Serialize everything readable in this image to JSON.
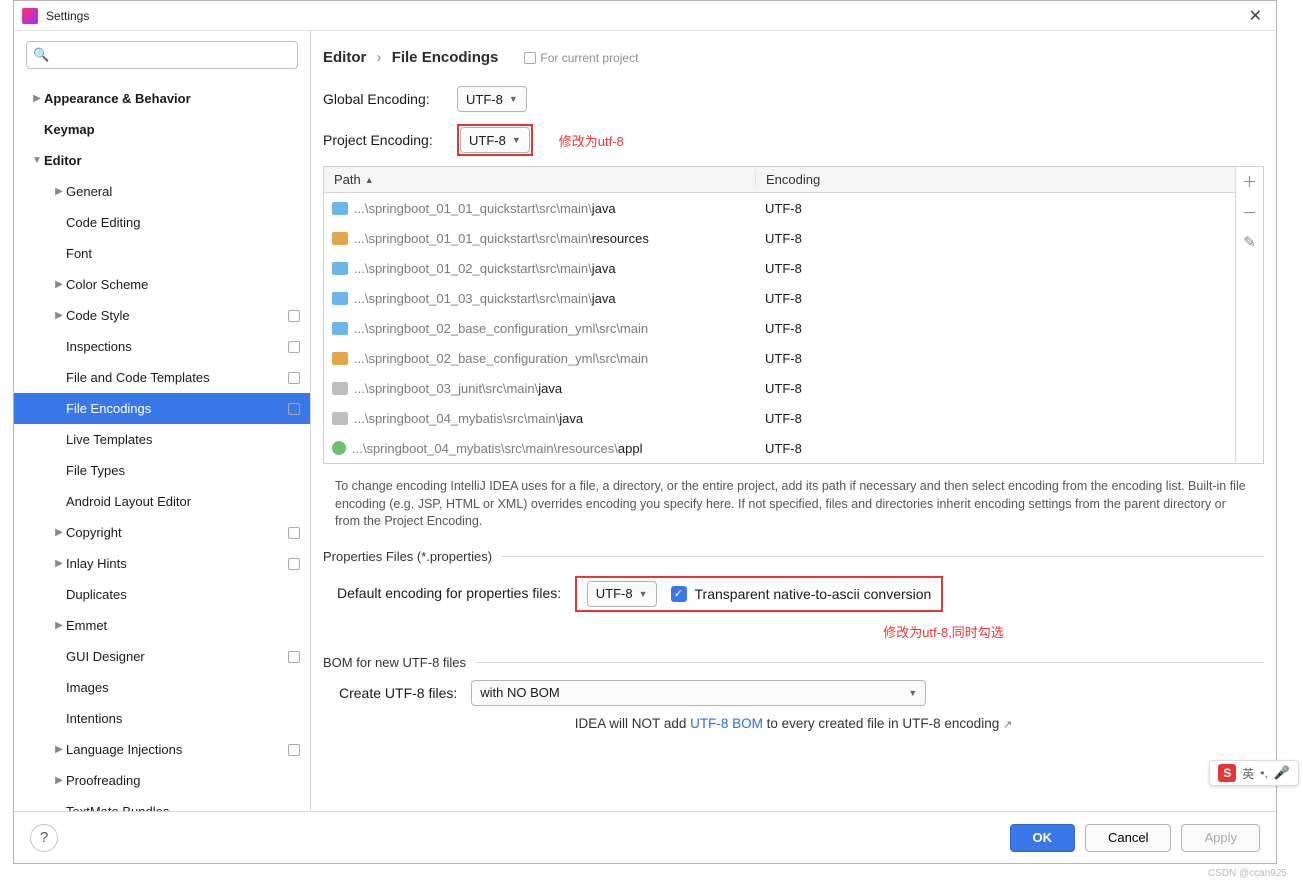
{
  "window": {
    "title": "Settings"
  },
  "sidebar": {
    "search_placeholder": "",
    "items": [
      {
        "label": "Appearance & Behavior",
        "level": 0,
        "arrow": "▶",
        "header": true
      },
      {
        "label": "Keymap",
        "level": 0,
        "arrow": "",
        "header": true
      },
      {
        "label": "Editor",
        "level": 0,
        "arrow": "▼",
        "header": true
      },
      {
        "label": "General",
        "level": 1,
        "arrow": "▶"
      },
      {
        "label": "Code Editing",
        "level": 1,
        "arrow": ""
      },
      {
        "label": "Font",
        "level": 1,
        "arrow": ""
      },
      {
        "label": "Color Scheme",
        "level": 1,
        "arrow": "▶"
      },
      {
        "label": "Code Style",
        "level": 1,
        "arrow": "▶",
        "badge": true
      },
      {
        "label": "Inspections",
        "level": 1,
        "arrow": "",
        "badge": true
      },
      {
        "label": "File and Code Templates",
        "level": 1,
        "arrow": "",
        "badge": true
      },
      {
        "label": "File Encodings",
        "level": 1,
        "arrow": "",
        "badge": true,
        "selected": true
      },
      {
        "label": "Live Templates",
        "level": 1,
        "arrow": ""
      },
      {
        "label": "File Types",
        "level": 1,
        "arrow": ""
      },
      {
        "label": "Android Layout Editor",
        "level": 1,
        "arrow": ""
      },
      {
        "label": "Copyright",
        "level": 1,
        "arrow": "▶",
        "badge": true
      },
      {
        "label": "Inlay Hints",
        "level": 1,
        "arrow": "▶",
        "badge": true
      },
      {
        "label": "Duplicates",
        "level": 1,
        "arrow": ""
      },
      {
        "label": "Emmet",
        "level": 1,
        "arrow": "▶"
      },
      {
        "label": "GUI Designer",
        "level": 1,
        "arrow": "",
        "badge": true
      },
      {
        "label": "Images",
        "level": 1,
        "arrow": ""
      },
      {
        "label": "Intentions",
        "level": 1,
        "arrow": ""
      },
      {
        "label": "Language Injections",
        "level": 1,
        "arrow": "▶",
        "badge": true
      },
      {
        "label": "Proofreading",
        "level": 1,
        "arrow": "▶"
      },
      {
        "label": "TextMate Bundles",
        "level": 1,
        "arrow": ""
      }
    ]
  },
  "breadcrumb": {
    "part1": "Editor",
    "part2": "File Encodings",
    "for_project": "For current project"
  },
  "global": {
    "label": "Global Encoding:",
    "value": "UTF-8"
  },
  "project": {
    "label": "Project Encoding:",
    "value": "UTF-8",
    "note": "修改为utf-8"
  },
  "table": {
    "col_path": "Path",
    "col_enc": "Encoding",
    "rows": [
      {
        "icon": "ic-blue",
        "prefix": "...\\springboot_01_01_quickstart\\src\\main\\",
        "strong": "java",
        "enc": "UTF-8"
      },
      {
        "icon": "ic-res",
        "prefix": "...\\springboot_01_01_quickstart\\src\\main\\",
        "strong": "resources",
        "enc": "UTF-8"
      },
      {
        "icon": "ic-blue",
        "prefix": "...\\springboot_01_02_quickstart\\src\\main\\",
        "strong": "java",
        "enc": "UTF-8"
      },
      {
        "icon": "ic-blue",
        "prefix": "...\\springboot_01_03_quickstart\\src\\main\\",
        "strong": "java",
        "enc": "UTF-8"
      },
      {
        "icon": "ic-blue",
        "prefix": "...\\springboot_02_base_configuration_yml\\src\\main",
        "strong": "",
        "enc": "UTF-8"
      },
      {
        "icon": "ic-res",
        "prefix": "...\\springboot_02_base_configuration_yml\\src\\main",
        "strong": "",
        "enc": "UTF-8"
      },
      {
        "icon": "ic-gray",
        "prefix": "...\\springboot_03_junit\\src\\main\\",
        "strong": "java",
        "enc": "UTF-8"
      },
      {
        "icon": "ic-gray",
        "prefix": "...\\springboot_04_mybatis\\src\\main\\",
        "strong": "java",
        "enc": "UTF-8"
      },
      {
        "icon": "ic-green",
        "prefix": "...\\springboot_04_mybatis\\src\\main\\resources\\",
        "strong": "appl",
        "enc": "UTF-8"
      }
    ]
  },
  "hint": "To change encoding IntelliJ IDEA uses for a file, a directory, or the entire project, add its path if necessary and then select encoding from the encoding list. Built-in file encoding (e.g. JSP, HTML or XML) overrides encoding you specify here. If not specified, files and directories inherit encoding settings from the parent directory or from the Project Encoding.",
  "props": {
    "section": "Properties Files (*.properties)",
    "label": "Default encoding for properties files:",
    "value": "UTF-8",
    "checkbox": "Transparent native-to-ascii conversion",
    "note": "修改为utf-8,同时勾选"
  },
  "bom": {
    "section": "BOM for new UTF-8 files",
    "label": "Create UTF-8 files:",
    "value": "with NO BOM",
    "hint_pre": "IDEA will NOT add ",
    "hint_link": "UTF-8 BOM",
    "hint_post": " to every created file in UTF-8 encoding "
  },
  "footer": {
    "ok": "OK",
    "cancel": "Cancel",
    "apply": "Apply"
  },
  "ime": {
    "lang": "英"
  },
  "watermark": "CSDN @ccan925"
}
